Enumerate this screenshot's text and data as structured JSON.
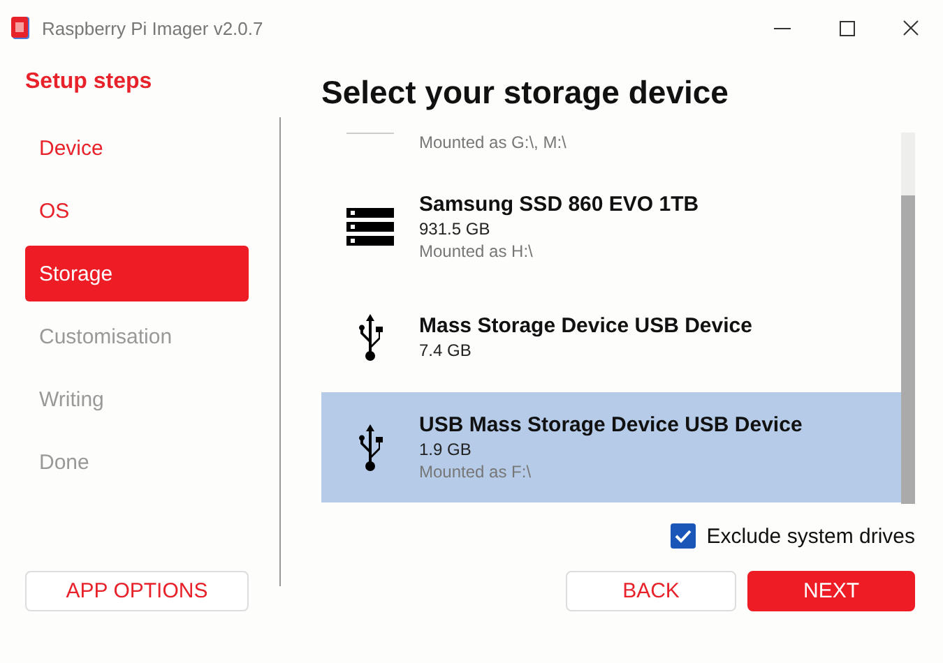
{
  "window": {
    "title": "Raspberry Pi Imager v2.0.7"
  },
  "sidebar": {
    "title": "Setup steps",
    "items": [
      {
        "label": "Device",
        "done": true,
        "selected": false
      },
      {
        "label": "OS",
        "done": true,
        "selected": false
      },
      {
        "label": "Storage",
        "done": false,
        "selected": true
      },
      {
        "label": "Customisation",
        "done": false,
        "selected": false
      },
      {
        "label": "Writing",
        "done": false,
        "selected": false
      },
      {
        "label": "Done",
        "done": false,
        "selected": false
      }
    ]
  },
  "heading": "Select your storage device",
  "drives": [
    {
      "kind": "partial",
      "mounted": "Mounted as G:\\, M:\\",
      "selected": false
    },
    {
      "kind": "disk",
      "name": "Samsung SSD 860 EVO 1TB",
      "size": "931.5 GB",
      "mounted": "Mounted as H:\\",
      "selected": false
    },
    {
      "kind": "usb",
      "name": "Mass Storage Device USB Device",
      "size": "7.4 GB",
      "selected": false
    },
    {
      "kind": "usb",
      "name": "USB Mass Storage Device USB Device",
      "size": "1.9 GB",
      "mounted": "Mounted as F:\\",
      "selected": true
    }
  ],
  "exclude_system_drives": {
    "label": "Exclude system drives",
    "checked": true
  },
  "buttons": {
    "app_options": "APP OPTIONS",
    "back": "BACK",
    "next": "NEXT"
  }
}
